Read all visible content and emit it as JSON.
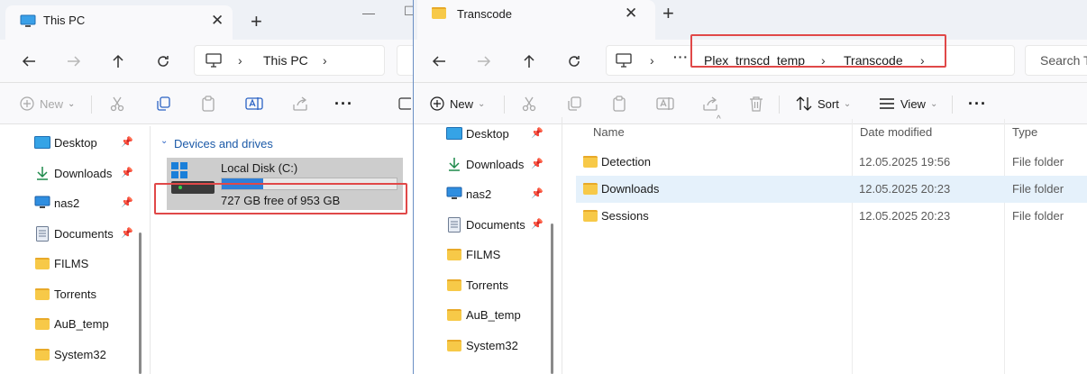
{
  "left_window": {
    "tab_title": "This PC",
    "address": [
      "This PC"
    ],
    "toolbar": {
      "new_label": "New"
    },
    "sidebar": [
      {
        "label": "Desktop",
        "icon": "desktop-icon",
        "pinned": true
      },
      {
        "label": "Downloads",
        "icon": "download-arrow-icon",
        "pinned": true
      },
      {
        "label": "nas2",
        "icon": "monitor-icon",
        "pinned": true
      },
      {
        "label": "Documents",
        "icon": "document-icon",
        "pinned": true
      },
      {
        "label": "FILMS",
        "icon": "folder-icon",
        "pinned": false
      },
      {
        "label": "Torrents",
        "icon": "folder-icon",
        "pinned": false
      },
      {
        "label": "AuB_temp",
        "icon": "folder-icon",
        "pinned": false
      },
      {
        "label": "System32",
        "icon": "folder-icon",
        "pinned": false
      }
    ],
    "section_title": "Devices and drives",
    "drive": {
      "name": "Local Disk (C:)",
      "free_text": "727 GB free of 953 GB",
      "used_fraction": 0.237,
      "bar_color": "#2f7fd6"
    }
  },
  "right_window": {
    "tab_title": "Transcode",
    "address": [
      "Plex_trnscd_temp",
      "Transcode"
    ],
    "search_placeholder": "Search T",
    "toolbar": {
      "new_label": "New",
      "sort_label": "Sort",
      "view_label": "View"
    },
    "sidebar": [
      {
        "label": "Desktop",
        "icon": "desktop-icon",
        "pinned": true
      },
      {
        "label": "Downloads",
        "icon": "download-arrow-icon",
        "pinned": true
      },
      {
        "label": "nas2",
        "icon": "monitor-icon",
        "pinned": true
      },
      {
        "label": "Documents",
        "icon": "document-icon",
        "pinned": true
      },
      {
        "label": "FILMS",
        "icon": "folder-icon",
        "pinned": false
      },
      {
        "label": "Torrents",
        "icon": "folder-icon",
        "pinned": false
      },
      {
        "label": "AuB_temp",
        "icon": "folder-icon",
        "pinned": false
      },
      {
        "label": "System32",
        "icon": "folder-icon",
        "pinned": false
      }
    ],
    "columns": {
      "name": "Name",
      "date": "Date modified",
      "type": "Type"
    },
    "files": [
      {
        "name": "Detection",
        "date": "12.05.2025 19:56",
        "type": "File folder",
        "selected": false
      },
      {
        "name": "Downloads",
        "date": "12.05.2025 20:23",
        "type": "File folder",
        "selected": true
      },
      {
        "name": "Sessions",
        "date": "12.05.2025 20:23",
        "type": "File folder",
        "selected": false
      }
    ]
  },
  "highlight_color": "#e04848",
  "accent_color": "#2f7fd6"
}
